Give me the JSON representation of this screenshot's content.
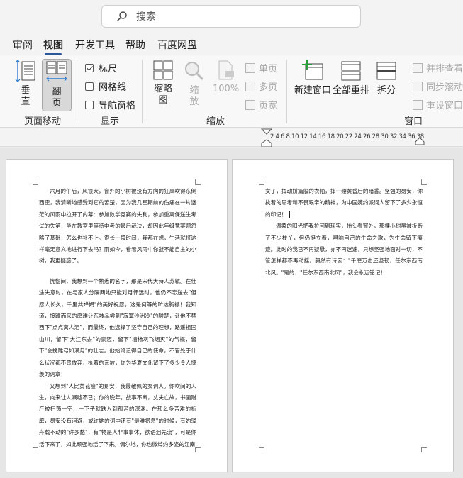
{
  "search": {
    "placeholder": "搜索",
    "icon": "search-icon"
  },
  "tabs": [
    {
      "label": "审阅",
      "active": false
    },
    {
      "label": "视图",
      "active": true
    },
    {
      "label": "开发工具",
      "active": false
    },
    {
      "label": "帮助",
      "active": false
    },
    {
      "label": "百度网盘",
      "active": false
    }
  ],
  "ribbon": {
    "page_move": {
      "label": "页面移动",
      "vertical": "垂直",
      "flip": "翻页"
    },
    "show": {
      "label": "显示",
      "ruler": {
        "label": "标尺",
        "checked": true
      },
      "gridlines": {
        "label": "网格线",
        "checked": false
      },
      "nav_pane": {
        "label": "导航窗格",
        "checked": false
      }
    },
    "zoom": {
      "label": "缩放",
      "zoom_btn": "缩略图",
      "zoom_disabled": "缩放",
      "percent": "100%",
      "one_page": "单页",
      "multi_page": "多页",
      "page_width": "页宽"
    },
    "window": {
      "label": "窗口",
      "new_window": "新建窗口",
      "arrange_all": "全部重排",
      "split": "拆分",
      "side_by_side": "并排查看",
      "sync_scroll": "同步滚动",
      "reset_window": "重设窗口"
    }
  },
  "ruler": {
    "numbers": "2 4 6 8 10 12 14 16 18 20 22 24 26 28 30 32 34 36 38"
  },
  "page1": {
    "p1": [
      "六月的午后，风很大，窗外的小树被没有方向的狂风吹得东倒",
      "西歪，我清晰地感受到它的苦楚，因为我几星期前的伤痛在一片迷",
      "茫的风雨中拉开了内幕：参加数学竞赛的失利，参加重离保送生考",
      "试的失第，坐在教室里等待中考的最后裁决，却因此年级竞赛题忽",
      "略了基础，怎么也补不上。很长一段时间，我都在想，生活就将这",
      "样毫无意义地进行下去吗？雨如今，看着风雨中你逝不能自主的小",
      "树，我更疑惑了。"
    ],
    "p2": [
      "恍惚间，我想到一个熟悉的名字，那是宋代大诗人苏轼。在仕",
      "途失意时，在与家人分隔两地只能对月怀远时，他仍不忘送去\"但愿",
      "人长久，千里共婵娟\"的美好祝愿，这是何等的旷达胸襟！我知道，",
      "接踵而来的磨难让东坡品尝到\"寂寞沙洲冷\"的酸楚，让他不禁西下\"",
      "点点离人泪\"，而最终，他选择了坚守自己的理想，路遥祖国山川，",
      "留下\"大江东去\"的豪迈，留下\"墙橹灰飞烟灭\"的气概，留下\"会挽雕",
      "弓如满月\"的壮志。他始终记得自己的使命，不管处于什么状况都不",
      "曾放弃，执着的东坡，你为华夏文化留下了多少令人惊羡的词章！"
    ],
    "p3": [
      "又想到\"人比黄花瘦\"的易安，我最敬佩的女词人。你吹间的人",
      "生，向来让人嘱嘘不已；你的晚年，战事不断，丈夫亡故，书画财",
      "产被扫荡一空，一下子就跌入到孤苦的深渊。在那么多苦难的折",
      "磨，易安没有沮避，或许她的词中还有\"最难将息\"的时候，有妁驳",
      "舟载不动的\"许多愁\"，有\"物是人非事事休，欲语泪先流\"，可是你",
      "活下来了，如此顽强地活了下来。偶尔地，你也微绰约多姿的江南"
    ]
  },
  "page2": {
    "p1": [
      "女子，挥动娇篇般的衣袖，摔一缕黄昏后的暗香。坚强的易安，你",
      "执着的思考和不畏艰辛的精神，为中国婉约派词人留下了多少永恒",
      "的印记！"
    ],
    "p2": [
      "温柔的阳光把我拉回到现实，抬头看窗外，那棵小树虽被折断了",
      "不少枝丫，但仍挺立着，唱响自己的生命之歌，为生命留下痕迹。此",
      "时的我已不再疑悬，亦不再迷速，只想坚强地面对一切，不管怎样都",
      "不再动摇。毅然有诗云：\"千磨万击还坚韧，任尔东西南北风。\"是的，",
      "\"任尔东西南北风\"，我会永远铭记！"
    ]
  }
}
